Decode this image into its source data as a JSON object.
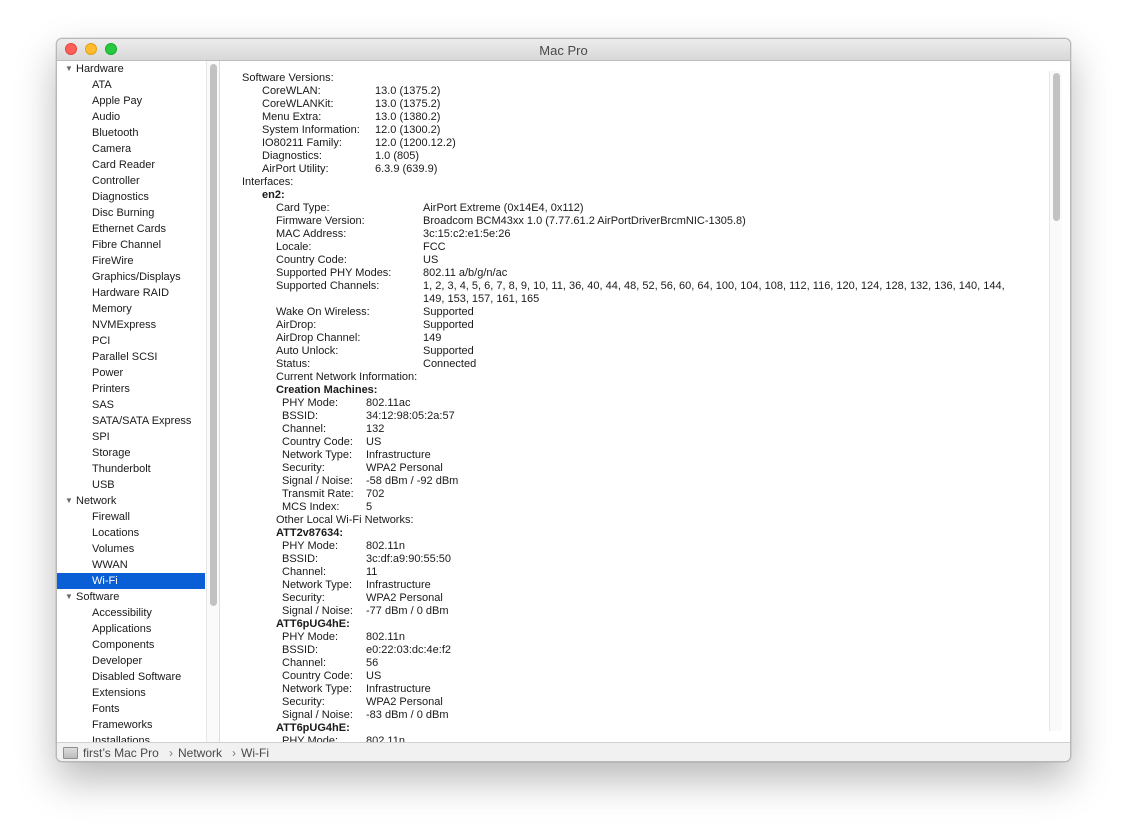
{
  "window": {
    "title": "Mac Pro"
  },
  "sidebar": {
    "rows": [
      {
        "type": "group",
        "label": "Hardware"
      },
      {
        "type": "item",
        "label": "ATA"
      },
      {
        "type": "item",
        "label": "Apple Pay"
      },
      {
        "type": "item",
        "label": "Audio"
      },
      {
        "type": "item",
        "label": "Bluetooth"
      },
      {
        "type": "item",
        "label": "Camera"
      },
      {
        "type": "item",
        "label": "Card Reader"
      },
      {
        "type": "item",
        "label": "Controller"
      },
      {
        "type": "item",
        "label": "Diagnostics"
      },
      {
        "type": "item",
        "label": "Disc Burning"
      },
      {
        "type": "item",
        "label": "Ethernet Cards"
      },
      {
        "type": "item",
        "label": "Fibre Channel"
      },
      {
        "type": "item",
        "label": "FireWire"
      },
      {
        "type": "item",
        "label": "Graphics/Displays"
      },
      {
        "type": "item",
        "label": "Hardware RAID"
      },
      {
        "type": "item",
        "label": "Memory"
      },
      {
        "type": "item",
        "label": "NVMExpress"
      },
      {
        "type": "item",
        "label": "PCI"
      },
      {
        "type": "item",
        "label": "Parallel SCSI"
      },
      {
        "type": "item",
        "label": "Power"
      },
      {
        "type": "item",
        "label": "Printers"
      },
      {
        "type": "item",
        "label": "SAS"
      },
      {
        "type": "item",
        "label": "SATA/SATA Express"
      },
      {
        "type": "item",
        "label": "SPI"
      },
      {
        "type": "item",
        "label": "Storage"
      },
      {
        "type": "item",
        "label": "Thunderbolt"
      },
      {
        "type": "item",
        "label": "USB"
      },
      {
        "type": "group",
        "label": "Network"
      },
      {
        "type": "item",
        "label": "Firewall"
      },
      {
        "type": "item",
        "label": "Locations"
      },
      {
        "type": "item",
        "label": "Volumes"
      },
      {
        "type": "item",
        "label": "WWAN"
      },
      {
        "type": "item",
        "label": "Wi-Fi",
        "selected": true
      },
      {
        "type": "group",
        "label": "Software"
      },
      {
        "type": "item",
        "label": "Accessibility"
      },
      {
        "type": "item",
        "label": "Applications"
      },
      {
        "type": "item",
        "label": "Components"
      },
      {
        "type": "item",
        "label": "Developer"
      },
      {
        "type": "item",
        "label": "Disabled Software"
      },
      {
        "type": "item",
        "label": "Extensions"
      },
      {
        "type": "item",
        "label": "Fonts"
      },
      {
        "type": "item",
        "label": "Frameworks"
      },
      {
        "type": "item",
        "label": "Installations"
      }
    ]
  },
  "content": {
    "lines": [
      {
        "indent": 0,
        "key": "Software Versions:"
      },
      {
        "indent": 1,
        "key": "CoreWLAN:",
        "value": "13.0 (1375.2)"
      },
      {
        "indent": 1,
        "key": "CoreWLANKit:",
        "value": "13.0 (1375.2)"
      },
      {
        "indent": 1,
        "key": "Menu Extra:",
        "value": "13.0 (1380.2)"
      },
      {
        "indent": 1,
        "key": "System Information:",
        "value": "12.0 (1300.2)"
      },
      {
        "indent": 1,
        "key": "IO80211 Family:",
        "value": "12.0 (1200.12.2)"
      },
      {
        "indent": 1,
        "key": "Diagnostics:",
        "value": "1.0 (805)"
      },
      {
        "indent": 1,
        "key": "AirPort Utility:",
        "value": "6.3.9 (639.9)"
      },
      {
        "indent": 0,
        "key": "Interfaces:"
      },
      {
        "indent": 1,
        "key": "en2:",
        "bold": true
      },
      {
        "indent": 2,
        "key": "Card Type:",
        "value": "AirPort Extreme  (0x14E4, 0x112)"
      },
      {
        "indent": 2,
        "key": "Firmware Version:",
        "value": "Broadcom BCM43xx 1.0 (7.77.61.2 AirPortDriverBrcmNIC-1305.8)"
      },
      {
        "indent": 2,
        "key": "MAC Address:",
        "value": "3c:15:c2:e1:5e:26"
      },
      {
        "indent": 2,
        "key": "Locale:",
        "value": "FCC"
      },
      {
        "indent": 2,
        "key": "Country Code:",
        "value": "US"
      },
      {
        "indent": 2,
        "key": "Supported PHY Modes:",
        "value": "802.11 a/b/g/n/ac"
      },
      {
        "indent": 2,
        "key": "Supported Channels:",
        "value": "1, 2, 3, 4, 5, 6, 7, 8, 9, 10, 11, 36, 40, 44, 48, 52, 56, 60, 64, 100, 104, 108, 112, 116, 120, 124, 128, 132, 136, 140, 144,"
      },
      {
        "indent": 2,
        "key": "",
        "value": "149, 153, 157, 161, 165"
      },
      {
        "indent": 2,
        "key": "Wake On Wireless:",
        "value": "Supported"
      },
      {
        "indent": 2,
        "key": "AirDrop:",
        "value": "Supported"
      },
      {
        "indent": 2,
        "key": "AirDrop Channel:",
        "value": "149"
      },
      {
        "indent": 2,
        "key": "Auto Unlock:",
        "value": "Supported"
      },
      {
        "indent": 2,
        "key": "Status:",
        "value": "Connected"
      },
      {
        "indent": 2,
        "key": "Current Network Information:"
      },
      {
        "indent": 3,
        "key": "Creation Machines:",
        "bold": true
      },
      {
        "indent": 4,
        "key": "PHY Mode:",
        "value": "802.11ac"
      },
      {
        "indent": 4,
        "key": "BSSID:",
        "value": "34:12:98:05:2a:57"
      },
      {
        "indent": 4,
        "key": "Channel:",
        "value": "132"
      },
      {
        "indent": 4,
        "key": "Country Code:",
        "value": "US"
      },
      {
        "indent": 4,
        "key": "Network Type:",
        "value": "Infrastructure"
      },
      {
        "indent": 4,
        "key": "Security:",
        "value": "WPA2 Personal"
      },
      {
        "indent": 4,
        "key": "Signal / Noise:",
        "value": "-58 dBm / -92 dBm"
      },
      {
        "indent": 4,
        "key": "Transmit Rate:",
        "value": "702"
      },
      {
        "indent": 4,
        "key": "MCS Index:",
        "value": "5"
      },
      {
        "indent": 2,
        "key": "Other Local Wi-Fi Networks:"
      },
      {
        "indent": 3,
        "key": "ATT2v87634:",
        "bold": true
      },
      {
        "indent": 4,
        "key": "PHY Mode:",
        "value": "802.11n"
      },
      {
        "indent": 4,
        "key": "BSSID:",
        "value": "3c:df:a9:90:55:50"
      },
      {
        "indent": 4,
        "key": "Channel:",
        "value": "11"
      },
      {
        "indent": 4,
        "key": "Network Type:",
        "value": "Infrastructure"
      },
      {
        "indent": 4,
        "key": "Security:",
        "value": "WPA2 Personal"
      },
      {
        "indent": 4,
        "key": "Signal / Noise:",
        "value": "-77 dBm / 0 dBm"
      },
      {
        "indent": 3,
        "key": "ATT6pUG4hE:",
        "bold": true
      },
      {
        "indent": 4,
        "key": "PHY Mode:",
        "value": "802.11n"
      },
      {
        "indent": 4,
        "key": "BSSID:",
        "value": "e0:22:03:dc:4e:f2"
      },
      {
        "indent": 4,
        "key": "Channel:",
        "value": "56"
      },
      {
        "indent": 4,
        "key": "Country Code:",
        "value": "US"
      },
      {
        "indent": 4,
        "key": "Network Type:",
        "value": "Infrastructure"
      },
      {
        "indent": 4,
        "key": "Security:",
        "value": "WPA2 Personal"
      },
      {
        "indent": 4,
        "key": "Signal / Noise:",
        "value": "-83 dBm / 0 dBm"
      },
      {
        "indent": 3,
        "key": "ATT6pUG4hE:",
        "bold": true
      },
      {
        "indent": 4,
        "key": "PHY Mode:",
        "value": "802.11n"
      }
    ]
  },
  "statusbar": {
    "path": [
      "first’s Mac Pro",
      "Network",
      "Wi-Fi"
    ],
    "separator": "›"
  }
}
